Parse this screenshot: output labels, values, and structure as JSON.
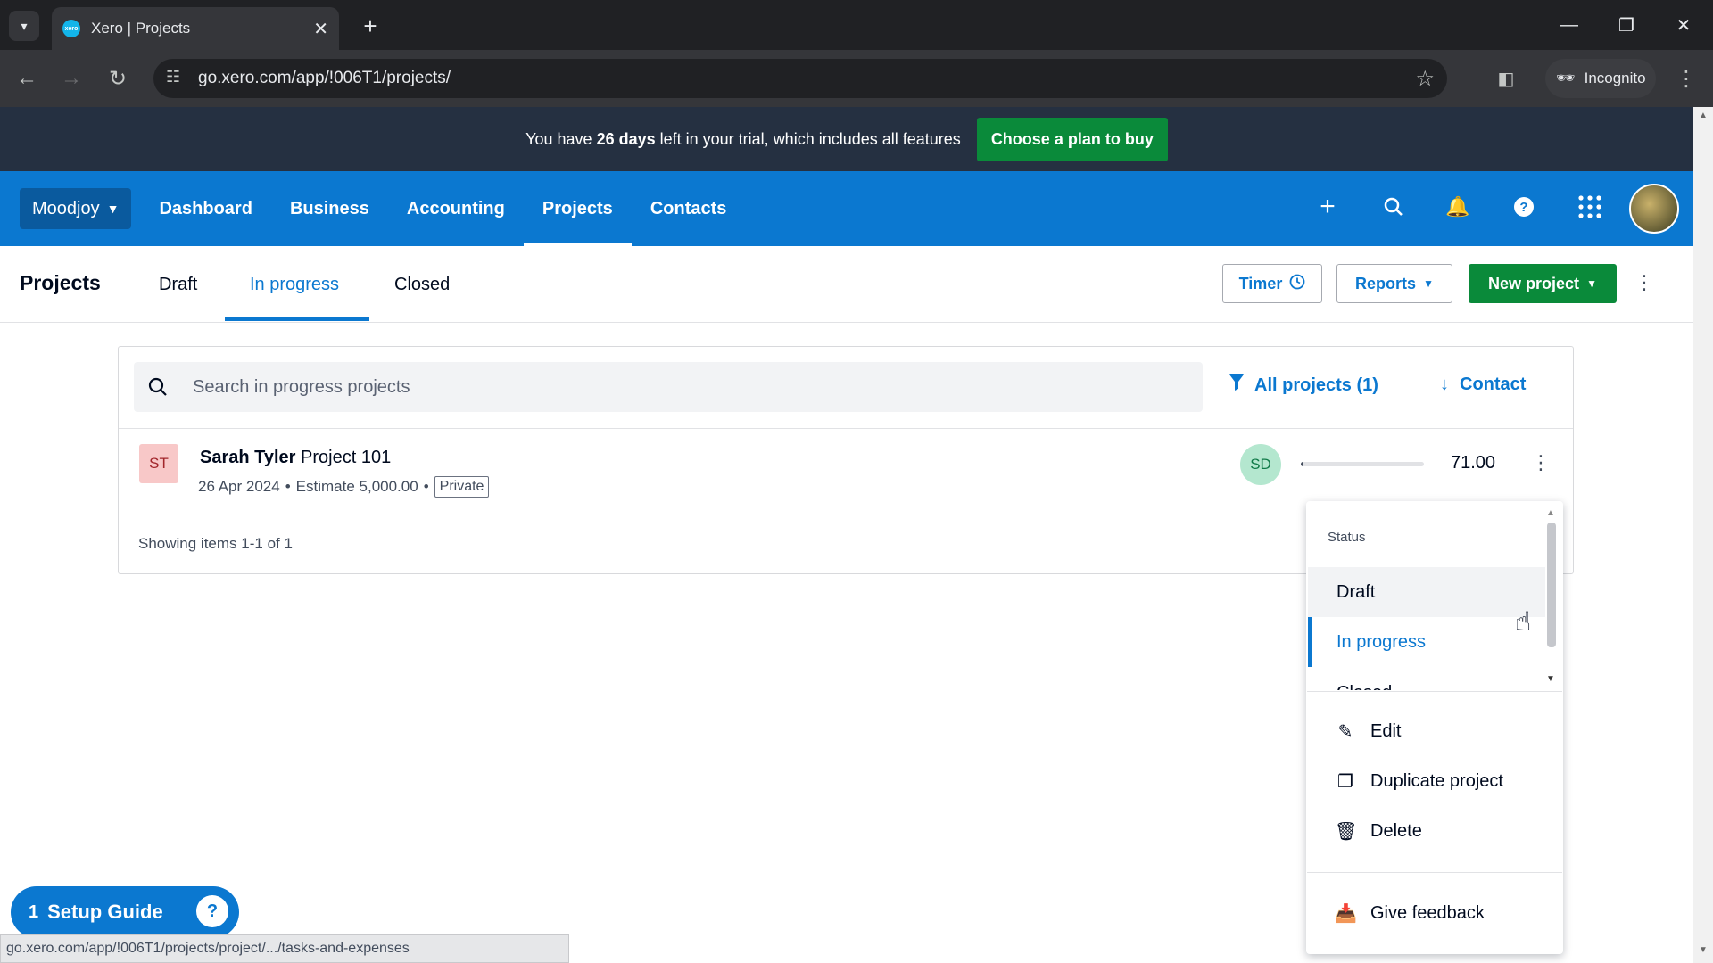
{
  "browser": {
    "tab_title": "Xero | Projects",
    "favicon_text": "xero",
    "url": "go.xero.com/app/!006T1/projects/",
    "incognito_label": "Incognito",
    "status_url": "go.xero.com/app/!006T1/projects/project/.../tasks-and-expenses"
  },
  "trial": {
    "msg_before": "You have ",
    "msg_days": "26 days",
    "msg_after": " left in your trial, which includes all features",
    "cta": "Choose a plan to buy"
  },
  "nav": {
    "org": "Moodjoy",
    "links": [
      "Dashboard",
      "Business",
      "Accounting",
      "Projects",
      "Contacts"
    ],
    "active": "Projects"
  },
  "subheader": {
    "title": "Projects",
    "tabs": [
      "Draft",
      "In progress",
      "Closed"
    ],
    "active_tab": "In progress",
    "timer": "Timer",
    "reports": "Reports",
    "new_project": "New project"
  },
  "list": {
    "search_placeholder": "Search in progress projects",
    "filter": "All projects (1)",
    "sort": "Contact",
    "rows": [
      {
        "initials": "ST",
        "contact": "Sarah Tyler",
        "project": "Project 101",
        "date": "26 Apr 2024",
        "estimate": "Estimate 5,000.00",
        "tag": "Private",
        "assignee": "SD",
        "progress": 0.014,
        "amount": "71.00"
      }
    ],
    "showing": "Showing items 1-1 of 1"
  },
  "menu": {
    "status_label": "Status",
    "status_options": [
      "Draft",
      "In progress",
      "Closed"
    ],
    "selected_status": "In progress",
    "actions": [
      "Edit",
      "Duplicate project",
      "Delete"
    ],
    "feedback": "Give feedback"
  },
  "setup_guide": {
    "count": "1",
    "label": "Setup Guide"
  },
  "colors": {
    "xero_blue": "#0b78d0",
    "trial_bg": "#253041",
    "action_green": "#0a8a3a"
  }
}
